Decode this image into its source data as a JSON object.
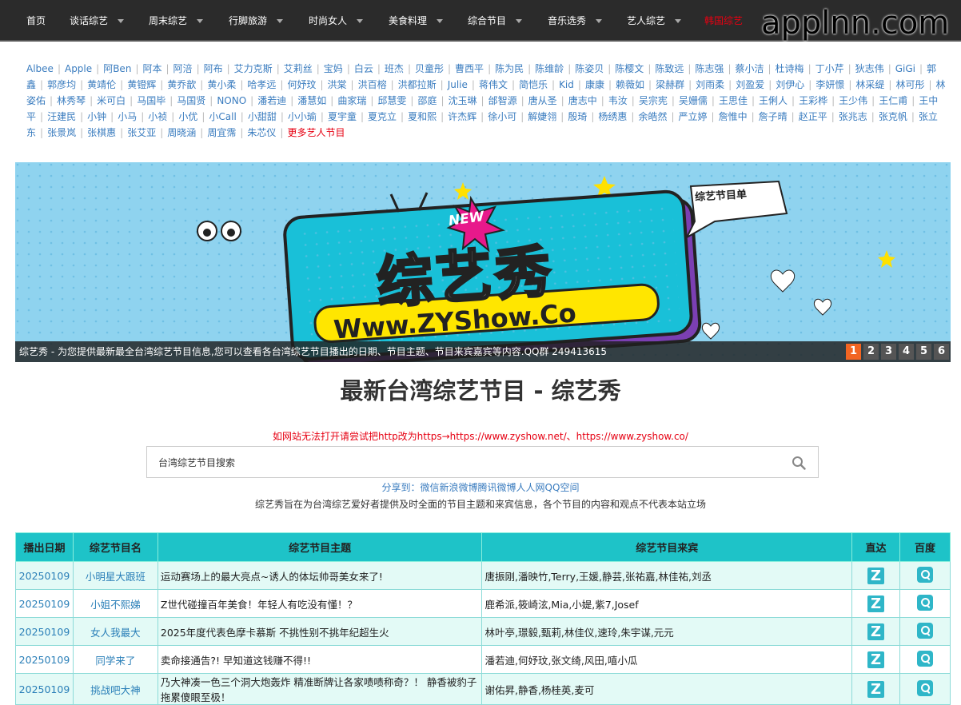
{
  "nav": {
    "items": [
      {
        "label": "首页",
        "dropdown": false,
        "red": false
      },
      {
        "label": "谈话综艺",
        "dropdown": true,
        "red": false
      },
      {
        "label": "周末综艺",
        "dropdown": true,
        "red": false
      },
      {
        "label": "行脚旅游",
        "dropdown": true,
        "red": false
      },
      {
        "label": "时尚女人",
        "dropdown": true,
        "red": false
      },
      {
        "label": "美食料理",
        "dropdown": true,
        "red": false
      },
      {
        "label": "综合节目",
        "dropdown": true,
        "red": false
      },
      {
        "label": "音乐选秀",
        "dropdown": true,
        "red": false
      },
      {
        "label": "艺人综艺",
        "dropdown": true,
        "red": false
      },
      {
        "label": "韩国综艺",
        "dropdown": false,
        "red": true
      }
    ],
    "watermark": "applnn.com"
  },
  "artists": [
    "Albee",
    "Apple",
    "阿Ben",
    "阿本",
    "阿涪",
    "阿布",
    "艾力克斯",
    "艾莉丝",
    "宝妈",
    "白云",
    "班杰",
    "贝童彤",
    "曹西平",
    "陈为民",
    "陈维龄",
    "陈姿贝",
    "陈樱文",
    "陈致远",
    "陈志强",
    "蔡小洁",
    "杜诗梅",
    "丁小芹",
    "狄志伟",
    "GiGi",
    "郭鑫",
    "郭彦均",
    "黄靖伦",
    "黄镫辉",
    "黄乔歆",
    "黄小柔",
    "哈孝远",
    "何妤玟",
    "洪棠",
    "洪百榕",
    "洪都拉斯",
    "Julie",
    "蒋伟文",
    "简恺乐",
    "Kid",
    "康康",
    "赖薇如",
    "梁赫群",
    "刘雨柔",
    "刘盈爱",
    "刘伊心",
    "李妍憬",
    "林采缇",
    "林可彤",
    "林姿佑",
    "林秀琴",
    "米可白",
    "马国毕",
    "马国贤",
    "NONO",
    "潘若迪",
    "潘慧如",
    "曲家瑞",
    "邱慧雯",
    "邵庭",
    "沈玉琳",
    "邰智源",
    "唐从圣",
    "唐志中",
    "韦汝",
    "吴宗宪",
    "吴姗儒",
    "王思佳",
    "王俐人",
    "王彩桦",
    "王少伟",
    "王仁甫",
    "王中平",
    "汪建民",
    "小钟",
    "小马",
    "小祯",
    "小优",
    "小Call",
    "小甜甜",
    "小小瑜",
    "夏宇童",
    "夏克立",
    "夏和熙",
    "许杰辉",
    "徐小可",
    "解婕翎",
    "殷琦",
    "杨绣惠",
    "余皓然",
    "严立婷",
    "詹惟中",
    "詹子晴",
    "赵正平",
    "张兆志",
    "张克帆",
    "张立东",
    "张景岚",
    "张棋惠",
    "张艾亚",
    "周晓涵",
    "周宜霈",
    "朱芯仪"
  ],
  "artists_more": "更多艺人节目",
  "banner": {
    "caption": "综艺秀 - 为您提供最新最全台湾综艺节目信息,您可以查看各台湾综艺节目播出的日期、节目主题、节目来宾嘉宾等内容.QQ群 249413615",
    "pages": [
      "1",
      "2",
      "3",
      "4",
      "5",
      "6"
    ],
    "active_page": "1",
    "new_badge": "NEW",
    "logo": "综艺秀",
    "url": "Www.ZYShow.Co",
    "tag": "综艺节目单"
  },
  "title": "最新台湾综艺节目 - 综艺秀",
  "notice": "如网站无法打开请尝试把http改为https→https://www.zyshow.net/、https://www.zyshow.co/",
  "search": {
    "placeholder": "台湾综艺节目搜索",
    "value": ""
  },
  "share": "分享到：微信新浪微博腾讯微博人人网QQ空间",
  "disclaimer": "综艺秀旨在为台湾综艺爱好者提供及时全面的节目主题和来宾信息，各个节目的内容和观点不代表本站立场",
  "table": {
    "headers": [
      "播出日期",
      "综艺节目名",
      "综艺节目主题",
      "综艺节目来宾",
      "直达",
      "百度"
    ],
    "rows": [
      {
        "date": "20250109",
        "name": "小明星大跟班",
        "topic": "运动赛场上的最大亮点~诱人的体坛帅哥美女来了!",
        "guests": "唐振刚,潘映竹,Terry,王媛,静芸,张祐嘉,林佳祐,刘丞"
      },
      {
        "date": "20250109",
        "name": "小姐不熙娣",
        "topic": "Z世代碰撞百年美食！年轻人有吃没有懂！？",
        "guests": "鹿希派,筱崎泫,Mia,小媞,紫7,Josef"
      },
      {
        "date": "20250109",
        "name": "女人我最大",
        "topic": "2025年度代表色摩卡慕斯 不挑性别不挑年纪超生火",
        "guests": "林叶亭,璟毅,甄莉,林佳仪,速玲,朱宇谋,元元"
      },
      {
        "date": "20250109",
        "name": "同学来了",
        "topic": "卖命接通告?! 早知道这钱赚不得!!",
        "guests": "潘若迪,何妤玟,张文绮,风田,嘻小瓜"
      },
      {
        "date": "20250109",
        "name": "挑战吧大神",
        "topic": "乃大神凑一色三个洞大炮轰炸 精准断牌让各家啧啧称奇？！ 静香被豹子拖累傻眼至极！",
        "guests": "谢佑昇,静香,杨桂英,麦可"
      }
    ]
  }
}
